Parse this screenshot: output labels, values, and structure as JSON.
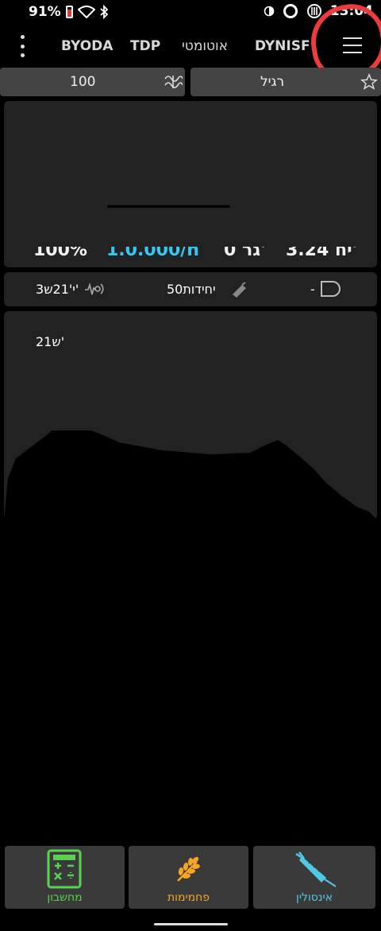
{
  "status_bar": {
    "battery": "91%",
    "time": "13:04"
  },
  "nav": {
    "tabs": [
      "BYODA",
      "TDP",
      "אוטומטי",
      "DYNISF"
    ]
  },
  "target_row": {
    "target_value": "100",
    "profile_name": "רגיל"
  },
  "metrics": {
    "iob": "3.24 יח'",
    "cob": "0 גר'",
    "basal": "1.0.000/h",
    "percent": "100%"
  },
  "info_row": {
    "cannula_value": "-",
    "reservoir": "50יחידות",
    "sensor_age": "3י'21ש'"
  },
  "graph": {
    "time_label": "21ש'"
  },
  "bottom_buttons": {
    "insulin": "אינסולין",
    "carbs": "פחמימות",
    "calculator": "מחשבון"
  },
  "colors": {
    "insulin_accent": "#4ec9e6",
    "carbs_accent": "#f5a623",
    "calculator_accent": "#59d150",
    "highlight_circle": "#ee3b3b"
  }
}
